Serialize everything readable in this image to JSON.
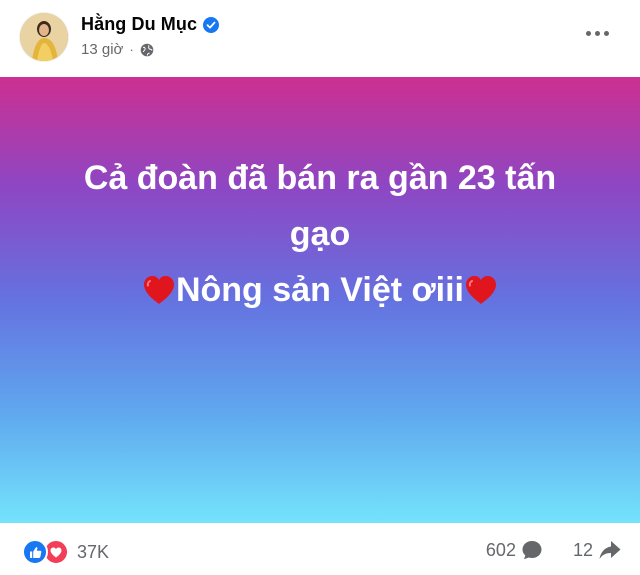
{
  "author": {
    "name": "Hằng Du Mục",
    "verified": true,
    "time": "13 giờ",
    "separator": "·",
    "privacy_icon": "globe-icon"
  },
  "post": {
    "lines": [
      "Cả đoàn đã bán ra gần 23 tấn",
      "gạo",
      "Nông sản Việt ơiii"
    ],
    "background_colors": [
      "#cd2f91",
      "#8d47c4",
      "#6572e0",
      "#5fa7ee",
      "#74e3fb"
    ],
    "emoji": "heart-icon"
  },
  "footer": {
    "reaction_count": "37K",
    "comments_count": "602",
    "shares_count": "12"
  },
  "colors": {
    "accent": "#1877f2",
    "love": "#f33e58",
    "muted": "#65676b"
  }
}
